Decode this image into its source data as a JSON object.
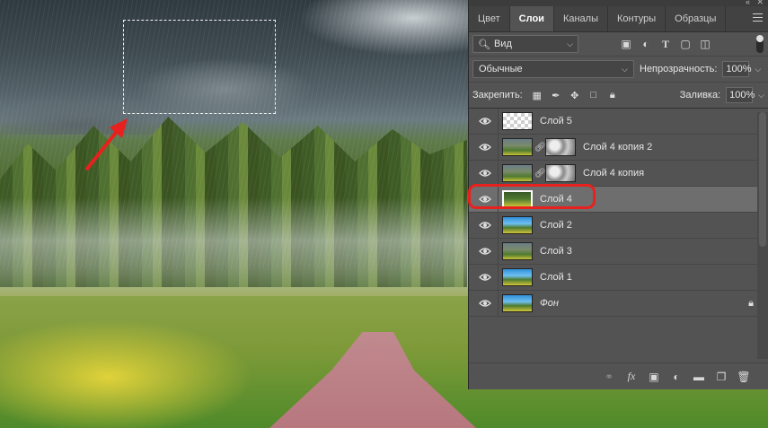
{
  "panel": {
    "tabs": [
      {
        "label": "Цвет",
        "active": false
      },
      {
        "label": "Слои",
        "active": true
      },
      {
        "label": "Каналы",
        "active": false
      },
      {
        "label": "Контуры",
        "active": false
      },
      {
        "label": "Образцы",
        "active": false
      }
    ],
    "filter_kind": "Вид",
    "blend_mode": "Обычные",
    "opacity_label": "Непрозрачность:",
    "opacity_value": "100%",
    "lock_label": "Закрепить:",
    "fill_label": "Заливка:",
    "fill_value": "100%",
    "layers": [
      {
        "name": "Слой 5",
        "thumb": "transparent",
        "mask": false,
        "selected": false,
        "italic": false,
        "locked": false
      },
      {
        "name": "Слой 4 копия 2",
        "thumb": "photo",
        "mask": true,
        "selected": false,
        "italic": false,
        "locked": false
      },
      {
        "name": "Слой 4 копия",
        "thumb": "photo",
        "mask": true,
        "selected": false,
        "italic": false,
        "locked": false
      },
      {
        "name": "Слой 4",
        "thumb": "green",
        "mask": false,
        "selected": true,
        "italic": false,
        "locked": false
      },
      {
        "name": "Слой 2",
        "thumb": "sky",
        "mask": false,
        "selected": false,
        "italic": false,
        "locked": false
      },
      {
        "name": "Слой 3",
        "thumb": "photo",
        "mask": false,
        "selected": false,
        "italic": false,
        "locked": false
      },
      {
        "name": "Слой 1",
        "thumb": "sky",
        "mask": false,
        "selected": false,
        "italic": false,
        "locked": false
      },
      {
        "name": "Фон",
        "thumb": "sky",
        "mask": false,
        "selected": false,
        "italic": true,
        "locked": true
      }
    ],
    "bottom_icons": [
      "link-icon",
      "fx-icon",
      "mask-icon",
      "adjustment-icon",
      "folder-icon",
      "new-layer-icon",
      "trash-icon"
    ]
  },
  "colors": {
    "panel_bg": "#535353",
    "selected_layer": "#6e6e6e",
    "annotation_red": "#e8201e"
  }
}
